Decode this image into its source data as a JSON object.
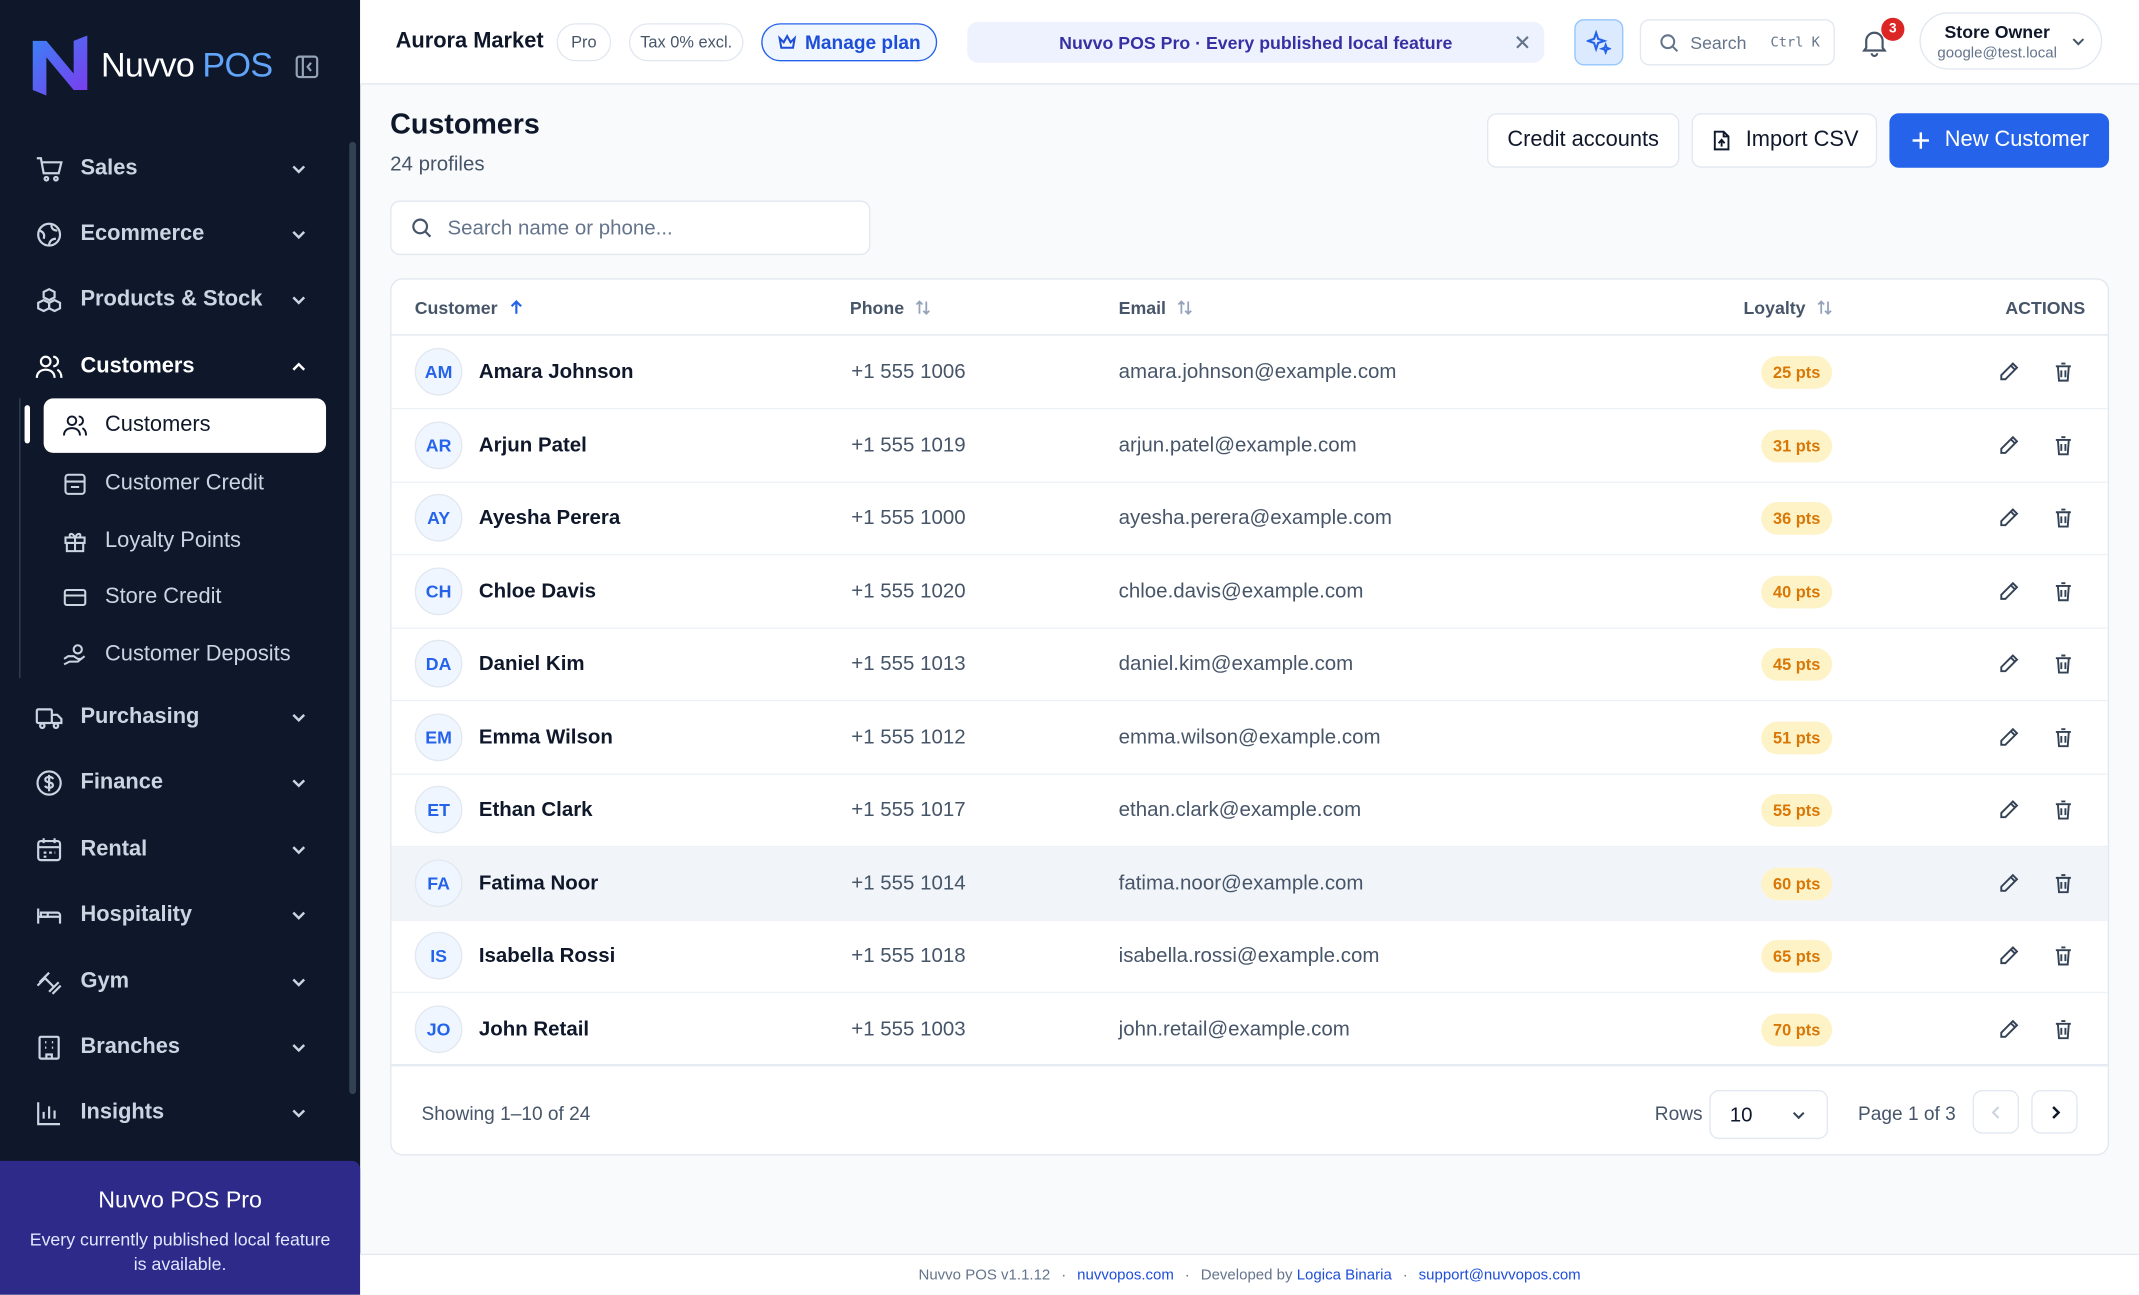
{
  "brand": {
    "name": "Nuvvo",
    "suffix": "POS"
  },
  "sidebar": {
    "groups": [
      {
        "label": "Sales"
      },
      {
        "label": "Ecommerce"
      },
      {
        "label": "Products & Stock"
      },
      {
        "label": "Customers"
      },
      {
        "label": "Purchasing"
      },
      {
        "label": "Finance"
      },
      {
        "label": "Rental"
      },
      {
        "label": "Hospitality"
      },
      {
        "label": "Gym"
      },
      {
        "label": "Branches"
      },
      {
        "label": "Insights"
      }
    ],
    "sub_items": [
      {
        "label": "Customers"
      },
      {
        "label": "Customer Credit"
      },
      {
        "label": "Loyalty Points"
      },
      {
        "label": "Store Credit"
      },
      {
        "label": "Customer Deposits"
      }
    ],
    "promo": {
      "title": "Nuvvo POS Pro",
      "text": "Every currently published local feature is available."
    }
  },
  "topbar": {
    "store": "Aurora Market",
    "plan": "Pro",
    "tax": "Tax 0% excl.",
    "manage": "Manage plan",
    "banner": "Nuvvo POS Pro · Every published local feature",
    "search": "Search",
    "shortcut": "Ctrl K",
    "notifications": "3",
    "user_name": "Store Owner",
    "user_email": "google@test.local"
  },
  "page": {
    "title": "Customers",
    "subtitle": "24 profiles",
    "credit_btn": "Credit accounts",
    "import_btn": "Import CSV",
    "new_btn": "New Customer",
    "search_placeholder": "Search name or phone..."
  },
  "table": {
    "headers": {
      "customer": "Customer",
      "phone": "Phone",
      "email": "Email",
      "loyalty": "Loyalty",
      "actions": "ACTIONS"
    },
    "rows": [
      {
        "initials": "AM",
        "name": "Amara Johnson",
        "phone": "+1 555 1006",
        "email": "amara.johnson@example.com",
        "loyalty": "25 pts"
      },
      {
        "initials": "AR",
        "name": "Arjun Patel",
        "phone": "+1 555 1019",
        "email": "arjun.patel@example.com",
        "loyalty": "31 pts"
      },
      {
        "initials": "AY",
        "name": "Ayesha Perera",
        "phone": "+1 555 1000",
        "email": "ayesha.perera@example.com",
        "loyalty": "36 pts"
      },
      {
        "initials": "CH",
        "name": "Chloe Davis",
        "phone": "+1 555 1020",
        "email": "chloe.davis@example.com",
        "loyalty": "40 pts"
      },
      {
        "initials": "DA",
        "name": "Daniel Kim",
        "phone": "+1 555 1013",
        "email": "daniel.kim@example.com",
        "loyalty": "45 pts"
      },
      {
        "initials": "EM",
        "name": "Emma Wilson",
        "phone": "+1 555 1012",
        "email": "emma.wilson@example.com",
        "loyalty": "51 pts"
      },
      {
        "initials": "ET",
        "name": "Ethan Clark",
        "phone": "+1 555 1017",
        "email": "ethan.clark@example.com",
        "loyalty": "55 pts"
      },
      {
        "initials": "FA",
        "name": "Fatima Noor",
        "phone": "+1 555 1014",
        "email": "fatima.noor@example.com",
        "loyalty": "60 pts"
      },
      {
        "initials": "IS",
        "name": "Isabella Rossi",
        "phone": "+1 555 1018",
        "email": "isabella.rossi@example.com",
        "loyalty": "65 pts"
      },
      {
        "initials": "JO",
        "name": "John Retail",
        "phone": "+1 555 1003",
        "email": "john.retail@example.com",
        "loyalty": "70 pts"
      }
    ],
    "showing": "Showing 1–10 of 24",
    "rows_label": "Rows",
    "rows_value": "10",
    "page_info": "Page 1 of 3"
  },
  "footer": {
    "version": "Nuvvo POS v1.1.12",
    "site": "nuvvopos.com",
    "dev_prefix": "Developed by",
    "dev": "Logica Binaria",
    "support": "support@nuvvopos.com"
  },
  "colors": {
    "sidebar": "#0f172a",
    "accent": "#2563eb",
    "promo": "#2e2a8a",
    "loyalty": "#d97706"
  }
}
